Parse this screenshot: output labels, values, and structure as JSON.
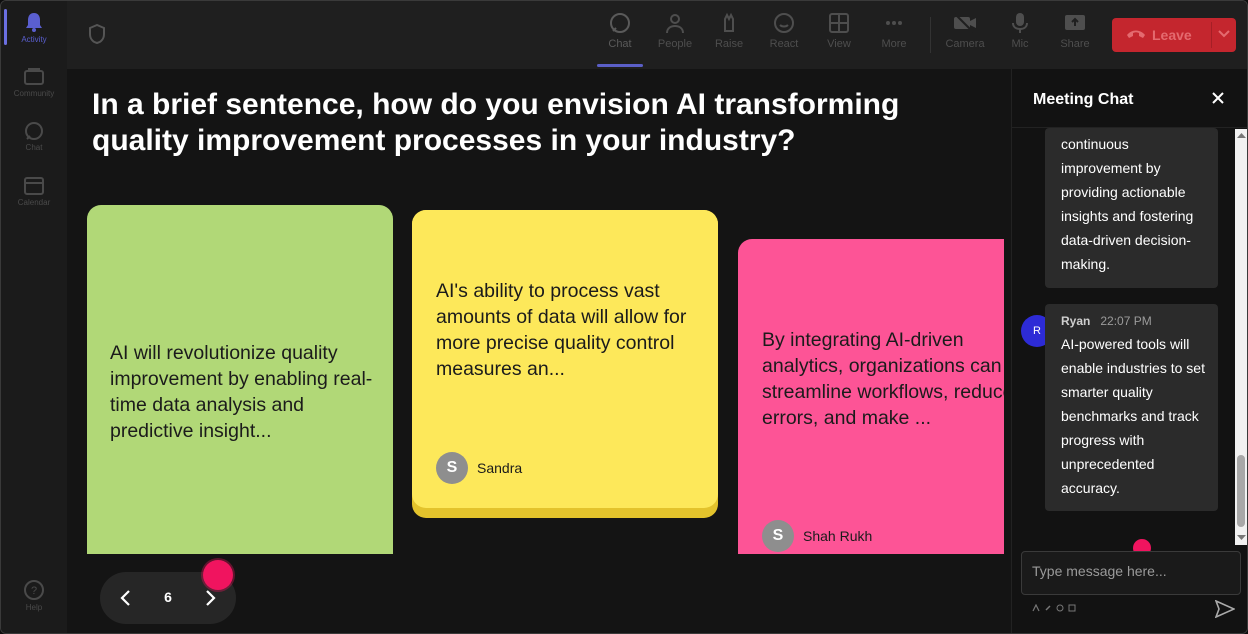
{
  "rail": {
    "items": [
      {
        "label": "Activity",
        "icon": "bell-icon"
      },
      {
        "label": "Community",
        "icon": "community-icon"
      },
      {
        "label": "Chat",
        "icon": "chat-icon"
      },
      {
        "label": "Calendar",
        "icon": "calendar-icon"
      },
      {
        "label": "Help",
        "icon": "help-icon"
      }
    ]
  },
  "toolbar": {
    "buttons": [
      {
        "label": "Chat",
        "icon": "chat-icon"
      },
      {
        "label": "People",
        "icon": "people-icon"
      },
      {
        "label": "Raise",
        "icon": "raise-hand-icon"
      },
      {
        "label": "React",
        "icon": "smiley-icon"
      },
      {
        "label": "View",
        "icon": "grid-view-icon"
      },
      {
        "label": "More",
        "icon": "more-icon"
      },
      {
        "label": "Camera",
        "icon": "camera-off-icon"
      },
      {
        "label": "Mic",
        "icon": "mic-icon"
      },
      {
        "label": "Share",
        "icon": "share-screen-icon"
      }
    ],
    "leave_label": "Leave",
    "leave_color": "#c4262e"
  },
  "main": {
    "question": "In a brief sentence, how do you envision AI transforming quality improvement processes in your industry?",
    "cards": [
      {
        "text": "AI will revolutionize quality improvement by enabling real-time data analysis and predictive insight...",
        "author": "",
        "color": "#b1d877"
      },
      {
        "text": "AI's ability to process vast amounts of data will allow for more precise quality control measures an...",
        "author": "Sandra",
        "initial": "S",
        "color": "#fde85a"
      },
      {
        "text": "By integrating AI-driven analytics, organizations can streamline workflows, reduce errors, and make ...",
        "author": "Shah Rukh",
        "initial": "S",
        "color": "#fd5496"
      }
    ],
    "pager": {
      "current": "6"
    }
  },
  "chat": {
    "title": "Meeting Chat",
    "messages": [
      {
        "sender": "",
        "time": "",
        "text": "continuous improvement by providing actionable insights and fostering data-driven decision-making."
      },
      {
        "sender": "Ryan",
        "initial": "R",
        "time": "22:07 PM",
        "text": "AI-powered tools will enable industries to set smarter quality benchmarks and track progress with unprecedented accuracy."
      }
    ],
    "input_placeholder": "Type message here..."
  },
  "colors": {
    "accent": "#5b5fc7",
    "pink_dot": "#f0145f",
    "leave": "#c4262e"
  }
}
